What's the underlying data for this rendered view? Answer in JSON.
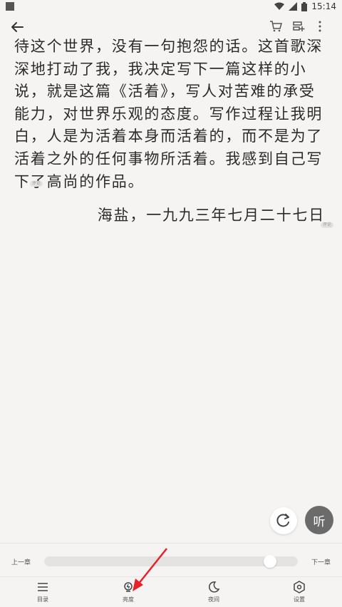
{
  "status_bar": {
    "time": "15:14"
  },
  "reader": {
    "paragraph": "待这个世界，没有一句抱怨的话。这首歌深深地打动了我，我决定写下一篇这样的小说，就是这篇《活着》，写人对苦难的承受能力，对世界乐观的态度。写作过程让我明白，人是为活着本身而活着的，而不是为了活着之外的任何事物所活着。我感到自己写下了高尚的作品。",
    "signature": "海盐，一九九三年七月二十七日",
    "note_badge": "评论"
  },
  "fab": {
    "listen_label": "听"
  },
  "progress": {
    "prev_label": "上一章",
    "next_label": "下一章",
    "value": 0.89
  },
  "nav": {
    "items": [
      {
        "label": "目录",
        "icon": "list-icon"
      },
      {
        "label": "亮度",
        "icon": "brightness-icon"
      },
      {
        "label": "夜间",
        "icon": "moon-icon"
      },
      {
        "label": "设置",
        "icon": "settings-icon"
      }
    ]
  },
  "colors": {
    "annotation_arrow": "#e8202a",
    "listen_button": "#6b6b6b"
  }
}
